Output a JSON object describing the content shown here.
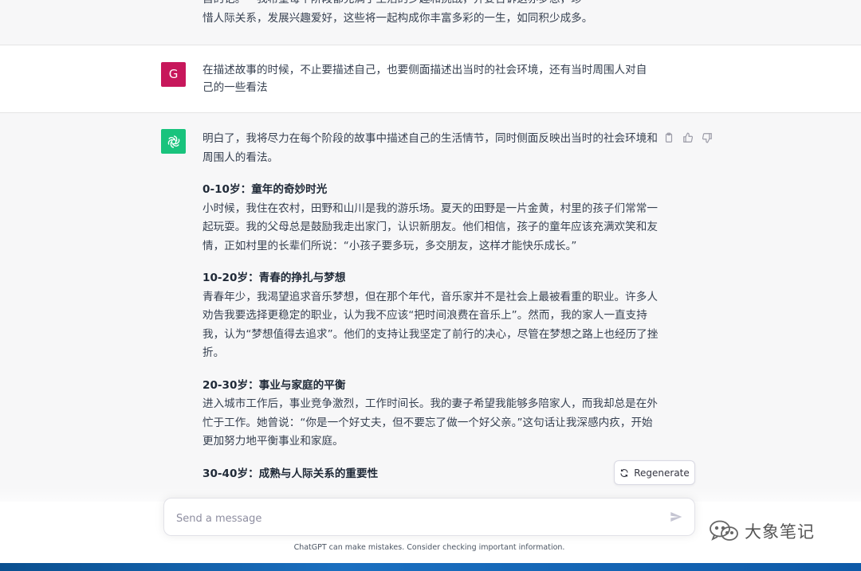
{
  "messages": {
    "prev_assistant_tail": {
      "line1": "自的记。一我希望每个阶段都充满了生活的乡趣和挑战，并要告诉这亦梦想，珍",
      "line2": "惜人际关系，发展兴趣爱好，这些将一起构成你丰富多彩的一生，如同积少成多。"
    },
    "user": {
      "avatar_letter": "G",
      "text": "在描述故事的时候，不止要描述自己，也要侧面描述出当时的社会环境，还有当时周围人对自己的一些看法"
    },
    "assistant": {
      "intro": "明白了，我将尽力在每个阶段的故事中描述自己的生活情节，同时侧面反映出当时的社会环境和周围人的看法。",
      "sections": [
        {
          "heading": "0-10岁：童年的奇妙时光",
          "body": "小时候，我住在农村，田野和山川是我的游乐场。夏天的田野是一片金黄，村里的孩子们常常一起玩耍。我的父母总是鼓励我走出家门，认识新朋友。他们相信，孩子的童年应该充满欢笑和友情，正如村里的长辈们所说：“小孩子要多玩，多交朋友，这样才能快乐成长。”"
        },
        {
          "heading": "10-20岁：青春的挣扎与梦想",
          "body": "青春年少，我渴望追求音乐梦想，但在那个年代，音乐家并不是社会上最被看重的职业。许多人劝告我要选择更稳定的职业，认为我不应该“把时间浪费在音乐上”。然而，我的家人一直支持我，认为“梦想值得去追求”。他们的支持让我坚定了前行的决心，尽管在梦想之路上也经历了挫折。"
        },
        {
          "heading": "20-30岁：事业与家庭的平衡",
          "body": "进入城市工作后，事业竞争激烈，工作时间长。我的妻子希望我能够多陪家人，而我却总是在外忙于工作。她曾说：“你是一个好丈夫，但不要忘了做一个好父亲。”这句话让我深感内疚，开始更加努力地平衡事业和家庭。"
        },
        {
          "heading": "30-40岁：成熟与人际关系的重要性",
          "body": ""
        }
      ]
    }
  },
  "actions": {
    "copy_icon": "clipboard-icon",
    "like_icon": "thumbs-up-icon",
    "dislike_icon": "thumbs-down-icon"
  },
  "regenerate": {
    "label": "Regenerate"
  },
  "composer": {
    "placeholder": "Send a message",
    "value": ""
  },
  "footer": {
    "disclaimer": "ChatGPT can make mistakes. Consider checking important information."
  },
  "watermark": {
    "text": "大象笔记"
  },
  "colors": {
    "user_avatar": "#c7175b",
    "gpt_avatar": "#19c37d",
    "assistant_bg": "#f7f7f8"
  }
}
